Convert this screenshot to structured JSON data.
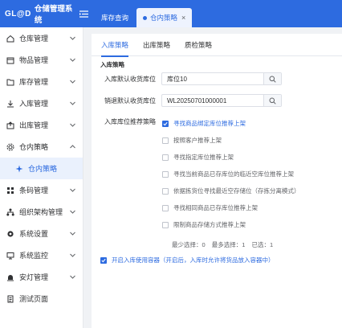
{
  "app": {
    "logo": "GL@D",
    "title": "仓储管理系统"
  },
  "top_tabs": [
    {
      "label": "库存查询",
      "active": false
    },
    {
      "label": "仓内策略",
      "active": true
    }
  ],
  "sidebar": {
    "items": [
      {
        "label": "仓库管理",
        "icon": "home-icon"
      },
      {
        "label": "物品管理",
        "icon": "box-icon"
      },
      {
        "label": "库存管理",
        "icon": "folder-icon"
      },
      {
        "label": "入库管理",
        "icon": "inbound-icon"
      },
      {
        "label": "出库管理",
        "icon": "outbound-icon"
      },
      {
        "label": "仓内策略",
        "icon": "gear-icon",
        "expanded": true
      },
      {
        "label": "仓内策略",
        "icon": "sparkle-icon",
        "sub": true,
        "active": true
      },
      {
        "label": "条码管理",
        "icon": "grid-icon"
      },
      {
        "label": "组织架构管理",
        "icon": "org-icon"
      },
      {
        "label": "系统设置",
        "icon": "settings-icon"
      },
      {
        "label": "系统监控",
        "icon": "monitor-icon"
      },
      {
        "label": "安灯管理",
        "icon": "lamp-icon"
      },
      {
        "label": "测试页面",
        "icon": "test-icon"
      }
    ]
  },
  "inner_tabs": [
    {
      "label": "入库策略",
      "active": true
    },
    {
      "label": "出库策略",
      "active": false
    },
    {
      "label": "质检策略",
      "active": false
    }
  ],
  "form": {
    "section_title": "入库策略",
    "default_location_label": "入库默认收货库位",
    "default_location_value": "库位10",
    "return_location_label": "销退默认收货库位",
    "return_location_value": "WL20250701000001",
    "recommend_label": "入库库位推荐策略",
    "strategies": [
      {
        "label": "寻找商品绑定库位推荐上架",
        "checked": true
      },
      {
        "label": "按照客户推荐上架",
        "checked": false
      },
      {
        "label": "寻找指定库位推荐上架",
        "checked": false
      },
      {
        "label": "寻找当前商品已存库位的临近空库位推荐上架",
        "checked": false
      },
      {
        "label": "依据拣货位寻找最近空存储位（存拣分离模式）",
        "checked": false
      },
      {
        "label": "寻找相同商品已存库位推荐上架",
        "checked": false
      },
      {
        "label": "限制商品存储方式推荐上架",
        "checked": false
      }
    ],
    "min_select": "最少选择：0",
    "max_select": "最多选择：1",
    "selected": "已选：1",
    "enable_container": "开启入库使用容器（开启后，入库时允许将货品放入容器中）"
  }
}
